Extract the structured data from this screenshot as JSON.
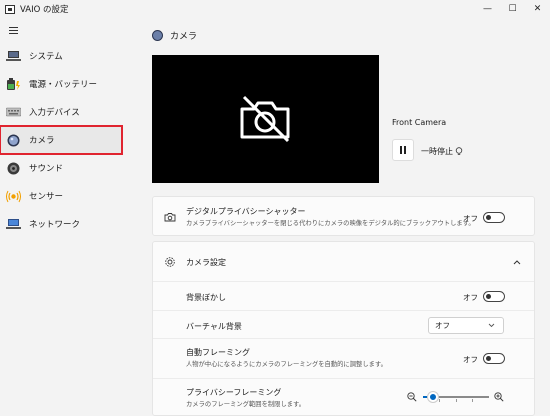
{
  "window": {
    "title": "VAIO の設定",
    "minimize": "—",
    "maximize": "☐",
    "close": "✕"
  },
  "sidebar": {
    "items": [
      {
        "label": "システム"
      },
      {
        "label": "電源・バッテリー"
      },
      {
        "label": "入力デバイス"
      },
      {
        "label": "カメラ",
        "selected": true
      },
      {
        "label": "サウンド"
      },
      {
        "label": "センサー"
      },
      {
        "label": "ネットワーク"
      }
    ]
  },
  "page": {
    "title": "カメラ"
  },
  "camera": {
    "name": "Front Camera",
    "pause_label": "一時停止"
  },
  "privacy_shutter": {
    "title": "デジタルプライバシーシャッター",
    "description": "カメラプライバシーシャッターを閉じる代わりにカメラの映像をデジタル的にブラックアウトします。",
    "state": "オフ"
  },
  "camera_settings": {
    "title": "カメラ設定",
    "background_blur": {
      "title": "背景ぼかし",
      "state": "オフ"
    },
    "virtual_background": {
      "title": "バーチャル背景",
      "value": "オフ"
    },
    "auto_framing": {
      "title": "自動フレーミング",
      "description": "人物が中心になるようにカメラのフレーミングを自動的に調整します。",
      "state": "オフ"
    },
    "privacy_framing": {
      "title": "プライバシーフレーミング",
      "description": "カメラのフレーミング範囲を制限します。",
      "slider_level": 0.15
    }
  },
  "colors": {
    "accent": "#0067c0",
    "highlight_outline": "#e0242f",
    "camera_blue": "#6b7fa8"
  }
}
